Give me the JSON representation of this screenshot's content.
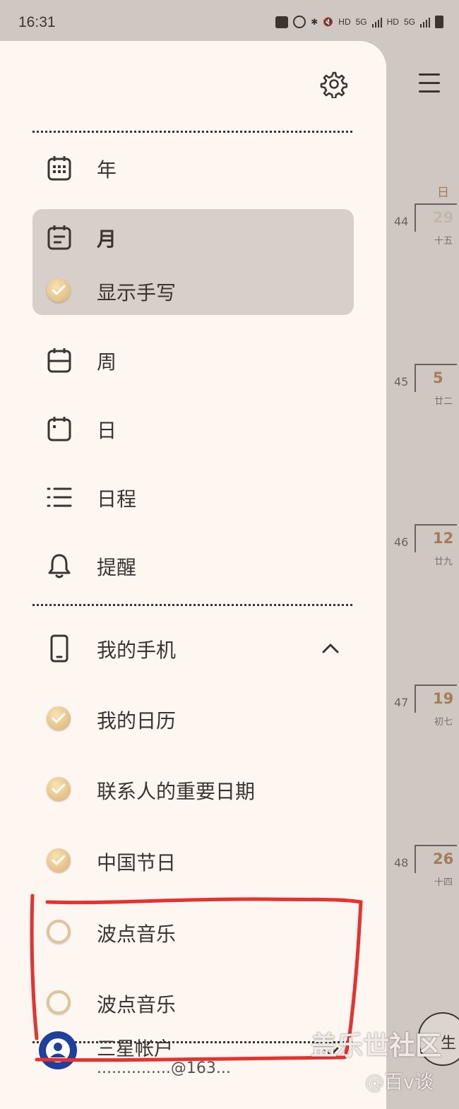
{
  "status_bar": {
    "time": "16:31",
    "indicators": [
      "HD",
      "5G",
      "HD",
      "5G"
    ]
  },
  "calendar_background": {
    "weekday_header": "日",
    "weeks": [
      {
        "week": "44",
        "day": "29",
        "lunar": "十五",
        "faded": true
      },
      {
        "week": "45",
        "day": "5",
        "lunar": "廿二",
        "faded": false
      },
      {
        "week": "46",
        "day": "12",
        "lunar": "廿九",
        "faded": false
      },
      {
        "week": "47",
        "day": "19",
        "lunar": "初七",
        "faded": false
      },
      {
        "week": "48",
        "day": "26",
        "lunar": "十四",
        "faded": false
      }
    ],
    "fab_glyph": "生"
  },
  "drawer": {
    "views": [
      {
        "label": "年",
        "icon": "calendar-grid-icon"
      },
      {
        "label": "月",
        "icon": "calendar-month-icon",
        "active": true
      },
      {
        "label": "显示手写",
        "icon": "check-circle-icon",
        "checked": true
      },
      {
        "label": "周",
        "icon": "calendar-week-icon"
      },
      {
        "label": "日",
        "icon": "calendar-day-icon"
      },
      {
        "label": "日程",
        "icon": "list-icon"
      },
      {
        "label": "提醒",
        "icon": "bell-icon"
      }
    ],
    "section_my_phone": {
      "label": "我的手机",
      "calendars": [
        {
          "label": "我的日历",
          "checked": true
        },
        {
          "label": "联系人的重要日期",
          "checked": true
        },
        {
          "label": "中国节日",
          "checked": true
        },
        {
          "label": "波点音乐",
          "checked": false
        },
        {
          "label": "波点音乐",
          "checked": false
        }
      ]
    },
    "account": {
      "label": "三星帐户",
      "sub": "...............@163..."
    }
  },
  "overlay": {
    "watermark": "盖乐世社区",
    "watermark_sub": "@百v谈",
    "annotation_color": "#e8312f"
  },
  "colors": {
    "drawer_bg": "#fdf6f1",
    "active_bg": "#d9cfca",
    "accent": "#a37d57",
    "text": "#3d3431"
  }
}
